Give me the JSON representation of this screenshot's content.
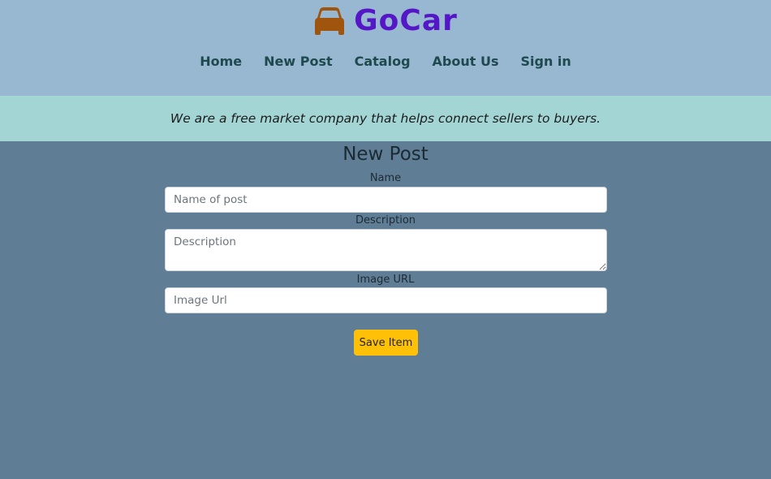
{
  "brand": {
    "name": "GoCar",
    "logo_icon": "car-icon",
    "logo_color": "#a0550f",
    "name_color": "#5516c7"
  },
  "nav": {
    "items": [
      {
        "label": "Home"
      },
      {
        "label": "New Post"
      },
      {
        "label": "Catalog"
      },
      {
        "label": "About Us"
      },
      {
        "label": "Sign in"
      }
    ]
  },
  "tagline": "We are a free market company that helps connect sellers to buyers.",
  "form": {
    "title": "New Post",
    "name_label": "Name",
    "name_placeholder": "Name of post",
    "description_label": "Description",
    "description_placeholder": "Description",
    "image_label": "Image URL",
    "image_placeholder": "Image Url",
    "save_label": "Save Item"
  },
  "colors": {
    "header_bg": "#98b7d1",
    "tagline_bg": "#a3d5d5",
    "page_bg": "#5f7d95",
    "save_button": "#ffc107"
  }
}
